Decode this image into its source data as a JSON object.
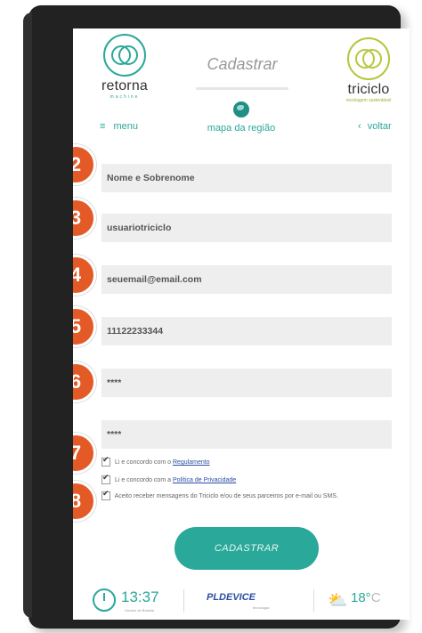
{
  "header": {
    "title": "Cadastrar",
    "logo_left": {
      "name": "retorna",
      "sub": "machine"
    },
    "logo_right": {
      "name": "triciclo",
      "sub": "reciclagem sustentável"
    },
    "map_label": "mapa da região",
    "menu_label": "menu",
    "back_label": "voltar",
    "menu_icon": "hamburger-icon",
    "back_icon": "chevron-left-icon"
  },
  "form": {
    "fields": [
      {
        "badge": "2",
        "value": "Nome e Sobrenome"
      },
      {
        "badge": "3",
        "value": "usuariotriciclo"
      },
      {
        "badge": "4",
        "value": "seuemail@email.com"
      },
      {
        "badge": "5",
        "value": "11122233344"
      },
      {
        "badge": "6",
        "value": "****"
      },
      {
        "badge": "",
        "value": "****"
      }
    ],
    "checks": [
      {
        "badge": "7",
        "text": "Li e concordo com o ",
        "link": "Regulamento"
      },
      {
        "badge": "",
        "text": "Li e concordo com a ",
        "link": "Política de Privacidade"
      },
      {
        "badge": "8",
        "text": "Aceito receber mensagens do Triciclo e/ou de seus parceiros por e-mail ou SMS.",
        "link": ""
      }
    ],
    "submit_label": "CADASTRAR"
  },
  "footer": {
    "time": "13:37",
    "time_sub": "Horário de Brasília",
    "sponsor": "PLDEVICE",
    "sponsor_sub": "tecnologia",
    "temp": "18°",
    "temp_unit": "C",
    "weather_icon": "sun-cloud-icon"
  },
  "colors": {
    "accent": "#2aa89a",
    "badge": "#e35a27",
    "link": "#2a4ea3"
  }
}
